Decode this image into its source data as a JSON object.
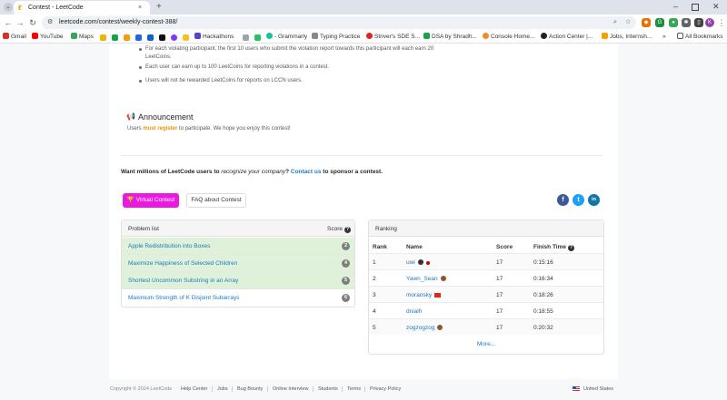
{
  "browser": {
    "tab_title": "Contest - LeetCode",
    "tab_close": "×",
    "new_tab": "+",
    "url": "leetcode.com/contest/weekly-contest-388/",
    "bookmarks": [
      {
        "label": "Gmail",
        "icon": "gmail-icon",
        "color": "#d93025"
      },
      {
        "label": "YouTube",
        "icon": "youtube-icon",
        "color": "#ff0000"
      },
      {
        "label": "Maps",
        "icon": "maps-icon",
        "color": "#34a853"
      },
      {
        "label": "Hackathons",
        "icon": "bookmark-icon",
        "color": "#5b3fd6"
      },
      {
        "label": "- Grammarly",
        "icon": "grammarly-icon",
        "color": "#15c39a"
      },
      {
        "label": "Typing Practice",
        "icon": "typing-icon",
        "color": "#888888"
      },
      {
        "label": "Striver's SDE S...",
        "icon": "striver-icon",
        "color": "#e02424"
      },
      {
        "label": "DSA by Shradh...",
        "icon": "dsa-icon",
        "color": "#16a34a"
      },
      {
        "label": "Console Home...",
        "icon": "aws-icon",
        "color": "#f08a24"
      },
      {
        "label": "Action Center |...",
        "icon": "action-center-icon",
        "color": "#222222"
      },
      {
        "label": "Jobs, Internsh...",
        "icon": "jobs-icon",
        "color": "#f4a300"
      }
    ],
    "bookmarks_more": "»",
    "all_bookmarks": "All Bookmarks"
  },
  "rules": [
    "For each violating participant, the first 10 users who submit the violation report towards this participant will each earn 20",
    "LeetCoins.",
    "Each user can earn up to 100 LeetCoins for reporting violations in a contest.",
    "Users will not be rewarded LeetCoins for reports on LCCN users."
  ],
  "announcement": {
    "title": "Announcement",
    "body_prefix": "Users ",
    "link": "must register",
    "body_suffix": " to participate. We hope you enjoy this contest!"
  },
  "sponsor": {
    "prefix": "Want millions of LeetCode users to ",
    "emphasis": "recognize your company",
    "middle": "? ",
    "link": "Contact us",
    "suffix": " to sponsor a contest."
  },
  "buttons": {
    "virtual": "Virtual Contest",
    "faq": "FAQ about Contest"
  },
  "social": {
    "facebook": "f",
    "twitter": "t",
    "linkedin": "in"
  },
  "problems": {
    "header": "Problem list",
    "score_header": "Score",
    "items": [
      {
        "name": "Apple Redistribution into Boxes",
        "score": "2",
        "solved": true
      },
      {
        "name": "Maximize Happiness of Selected Children",
        "score": "4",
        "solved": true
      },
      {
        "name": "Shortest Uncommon Substring in an Array",
        "score": "5",
        "solved": true
      },
      {
        "name": "Maximum Strength of K Disjoint Subarrays",
        "score": "6",
        "solved": false
      }
    ]
  },
  "ranking": {
    "header": "Ranking",
    "columns": [
      "Rank",
      "Name",
      "Score",
      "Finish Time"
    ],
    "rows": [
      {
        "rank": "1",
        "name": "uwi",
        "score": "17",
        "time": "0:15:16"
      },
      {
        "rank": "2",
        "name": "Yawn_Sean",
        "score": "17",
        "time": "0:16:34"
      },
      {
        "rank": "3",
        "name": "moransky",
        "score": "17",
        "time": "0:18:26"
      },
      {
        "rank": "4",
        "name": "dnialh",
        "score": "17",
        "time": "0:18:55"
      },
      {
        "rank": "5",
        "name": "zogzogzog",
        "score": "17",
        "time": "0:20:32"
      }
    ],
    "more": "More..."
  },
  "footer": {
    "copyright": "Copyright © 2024 LeetCode",
    "links": [
      "Help Center",
      "Jobs",
      "Bug Bounty",
      "Online Interview",
      "Students",
      "Terms",
      "Privacy Policy"
    ],
    "region": "United States"
  }
}
